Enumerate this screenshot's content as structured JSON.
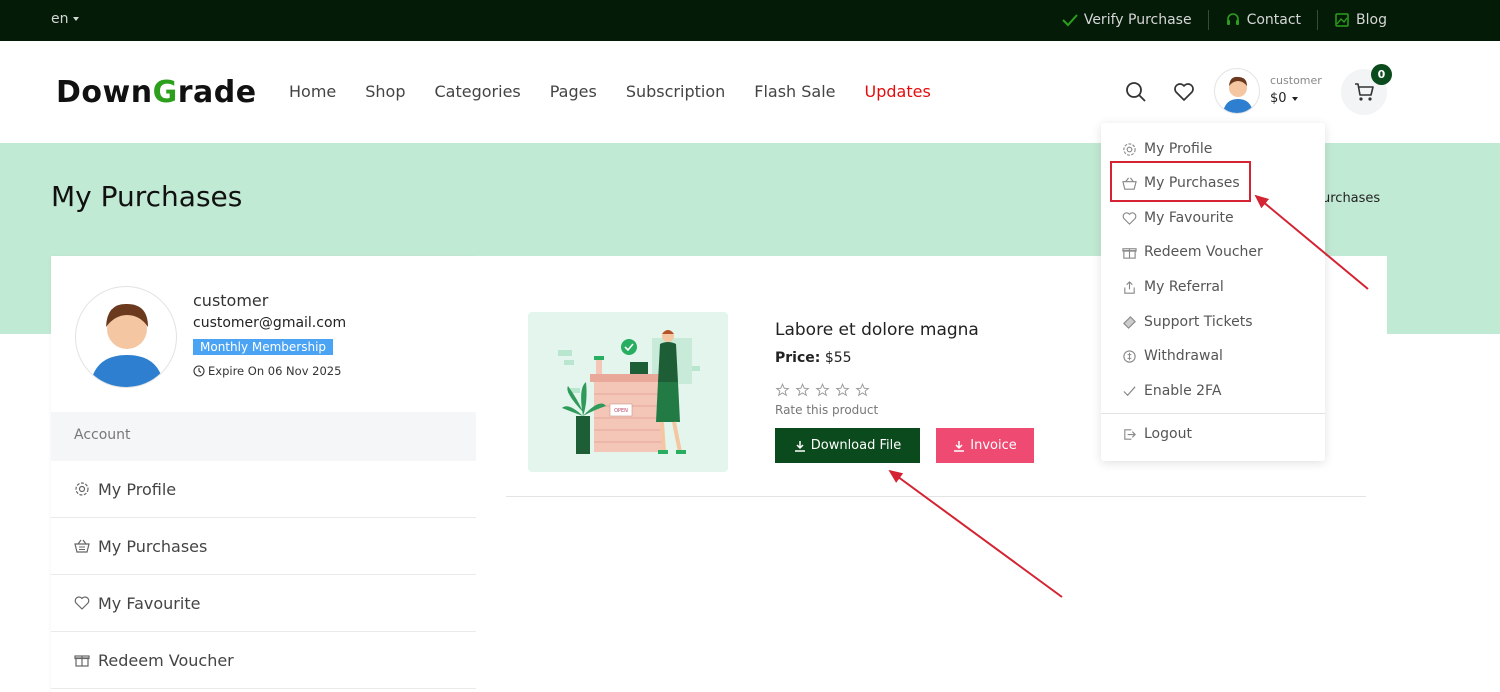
{
  "topbar": {
    "language": "en",
    "links": [
      {
        "label": "Verify Purchase",
        "icon": "check-icon"
      },
      {
        "label": "Contact",
        "icon": "headset-icon"
      },
      {
        "label": "Blog",
        "icon": "image-icon"
      }
    ]
  },
  "header": {
    "logo_part1": "Down",
    "logo_part2": "G",
    "logo_part3": "rade",
    "nav": [
      "Home",
      "Shop",
      "Categories",
      "Pages",
      "Subscription",
      "Flash Sale",
      "Updates"
    ],
    "user_name": "customer",
    "user_balance": "$0",
    "cart_count": "0"
  },
  "banner": {
    "title": "My Purchases",
    "breadcrumb_tail": "urchases"
  },
  "profile": {
    "name": "customer",
    "email": "customer@gmail.com",
    "membership": "Monthly Membership",
    "expire": "Expire On 06 Nov 2025"
  },
  "sidebar": {
    "section": "Account",
    "items": [
      "My Profile",
      "My Purchases",
      "My Favourite",
      "Redeem Voucher"
    ]
  },
  "product": {
    "title": "Labore et dolore magna",
    "price_label": "Price:",
    "price": "$55",
    "rate_text": "Rate this product",
    "download_label": "Download File",
    "invoice_label": "Invoice",
    "sign_text": "OPEN"
  },
  "dropdown": {
    "items": [
      "My Profile",
      "My Purchases",
      "My Favourite",
      "Redeem Voucher",
      "My Referral",
      "Support Tickets",
      "Withdrawal",
      "Enable 2FA"
    ],
    "logout": "Logout"
  },
  "colors": {
    "topbar": "#031b07",
    "banner": "#c1ead4",
    "primary": "#0b4a1c",
    "invoice": "#ef4a72",
    "nav_active": "#e30d0d",
    "annotation": "#d42332"
  }
}
